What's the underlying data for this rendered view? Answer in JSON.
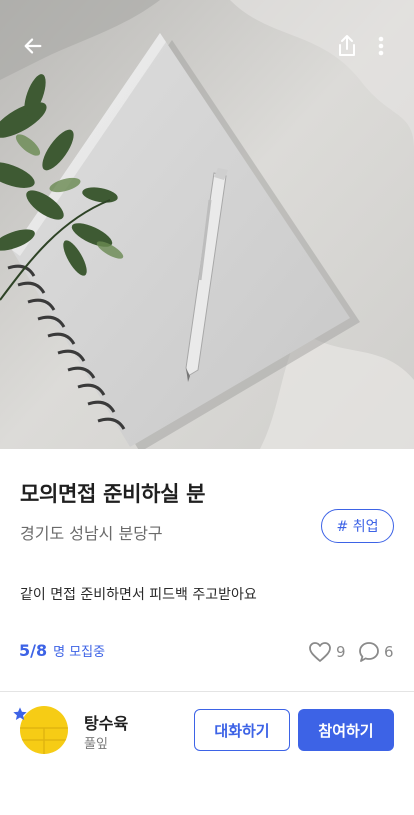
{
  "post": {
    "title": "모의면접 준비하실 분",
    "location": "경기도 성남시 분당구",
    "tag": "# 취업",
    "description": "같이 면접 준비하면서 피드백 주고받아요"
  },
  "recruit": {
    "count": "5/8",
    "label": "명 모집중"
  },
  "stats": {
    "likes": "9",
    "comments": "6"
  },
  "host": {
    "name": "탕수육",
    "subtitle": "풀잎"
  },
  "actions": {
    "chat_label": "대화하기",
    "join_label": "참여하기"
  },
  "icons": {
    "back": "arrow-left-icon",
    "share": "share-icon",
    "more": "more-vertical-icon",
    "like": "heart-icon",
    "comment": "comment-icon",
    "badge": "star-icon"
  },
  "colors": {
    "accent": "#3d63e6",
    "avatar": "#f6cc15"
  }
}
